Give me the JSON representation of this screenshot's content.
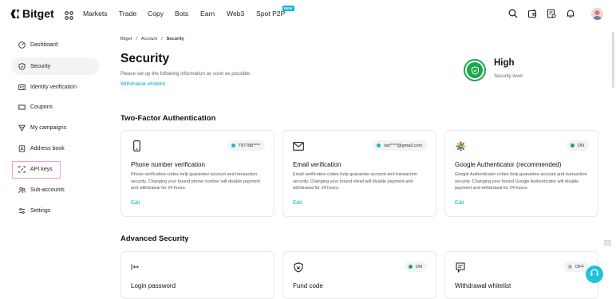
{
  "brand": {
    "name": "Bitget"
  },
  "nav": {
    "items": [
      "Markets",
      "Trade",
      "Copy",
      "Bots",
      "Earn",
      "Web3",
      "Spot P2P"
    ],
    "new_badge": "NEW"
  },
  "sidebar": {
    "items": [
      {
        "label": "Dashboard",
        "icon": "dashboard-icon"
      },
      {
        "label": "Security",
        "icon": "shield-icon",
        "active": true
      },
      {
        "label": "Identity verification",
        "icon": "id-card-icon"
      },
      {
        "label": "Coupons",
        "icon": "coupon-icon"
      },
      {
        "label": "My campaigns",
        "icon": "trophy-icon"
      },
      {
        "label": "Address book",
        "icon": "address-book-icon"
      },
      {
        "label": "API keys",
        "icon": "api-key-icon"
      },
      {
        "label": "Sub-accounts",
        "icon": "users-icon"
      },
      {
        "label": "Settings",
        "icon": "settings-sliders-icon"
      }
    ]
  },
  "breadcrumb": {
    "items": [
      "Bitget",
      "Account",
      "Security"
    ],
    "separator": "/"
  },
  "page": {
    "title": "Security",
    "description": "Please set up the following information as soon as possible:",
    "whitelist_link": "Withdrawal whitelist"
  },
  "security_level": {
    "value": "High",
    "label": "Security level",
    "color": "#1ba94c"
  },
  "two_factor": {
    "title": "Two-Factor Authentication",
    "cards": [
      {
        "icon": "phone-icon",
        "status": "797788****",
        "title": "Phone number verification",
        "description": "Phone verification codes help guarantee account and transaction security. Changing your bound phone number will disable payment and withdrawal for 24 hours.",
        "action": "Edit"
      },
      {
        "icon": "mail-icon",
        "status": "tah****@gmail.com",
        "title": "Email verification",
        "description": "Email verification codes help guarantee account and transaction security. Changing your bound email will disable payment and withdrawal for 24 hours.",
        "action": "Edit"
      },
      {
        "icon": "google-authenticator-icon",
        "status": "ON",
        "title": "Google Authenticator (recommended)",
        "description": "Google Authenticator codes help guarantee account and transaction security. Changing your bound Google Authenticator will disable payment and withdrawal for 24 hours.",
        "action": "Edit"
      }
    ]
  },
  "advanced": {
    "title": "Advanced Security",
    "cards": [
      {
        "icon": "password-icon",
        "status": "",
        "title": "Login password"
      },
      {
        "icon": "fund-code-icon",
        "status": "ON",
        "title": "Fund code"
      },
      {
        "icon": "whitelist-icon",
        "status": "OFF",
        "title": "Withdrawal whitelist"
      }
    ]
  },
  "colors": {
    "accent": "#00a3c4",
    "success": "#1ba94c",
    "highlight": "#f0a0c8"
  }
}
